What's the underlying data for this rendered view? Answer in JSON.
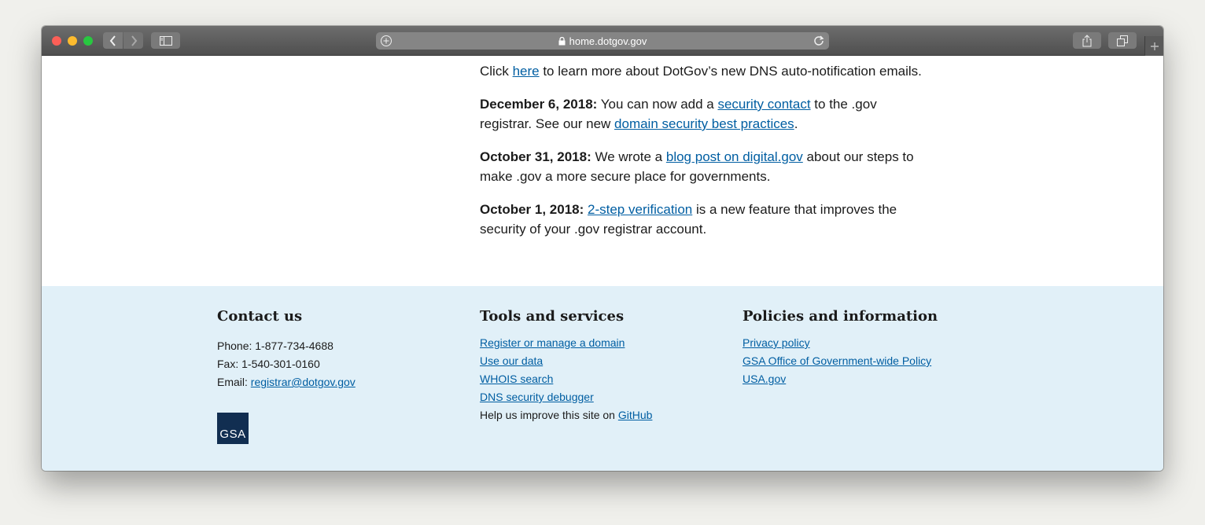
{
  "browser": {
    "url": "home.dotgov.gov"
  },
  "news": {
    "intro": {
      "text_before": "Click ",
      "link": "here",
      "text_after": " to learn more about DotGov’s new DNS auto-notification emails."
    },
    "items": [
      {
        "date": "December 6, 2018:",
        "text1": " You can now add a ",
        "link1": "security contact",
        "text2": " to the .gov registrar. See our new ",
        "link2": "domain security best practices",
        "text3": "."
      },
      {
        "date": "October 31, 2018:",
        "text1": " We wrote a ",
        "link1": "blog post on digital.gov",
        "text2": " about our steps to make .gov a more secure place for governments."
      },
      {
        "date": "October 1, 2018:",
        "text1": " ",
        "link1": "2-step verification",
        "text2": " is a new feature that improves the security of your .gov registrar account."
      }
    ]
  },
  "footer": {
    "contact": {
      "heading": "Contact us",
      "phone": "Phone: 1-877-734-4688",
      "fax": "Fax: 1-540-301-0160",
      "email_label": "Email: ",
      "email": "registrar@dotgov.gov"
    },
    "tools": {
      "heading": "Tools and services",
      "links": [
        "Register or manage a domain",
        "Use our data",
        "WHOIS search",
        "DNS security debugger"
      ],
      "help_text": "Help us improve this site on ",
      "help_link": "GitHub"
    },
    "policies": {
      "heading": "Policies and information",
      "links": [
        "Privacy policy",
        "GSA Office of Government-wide Policy",
        "USA.gov"
      ]
    },
    "logo_text": "GSA"
  },
  "colors": {
    "link": "#005ea2",
    "footer_bg": "#e1f0f8",
    "gsa_logo": "#112e51"
  }
}
